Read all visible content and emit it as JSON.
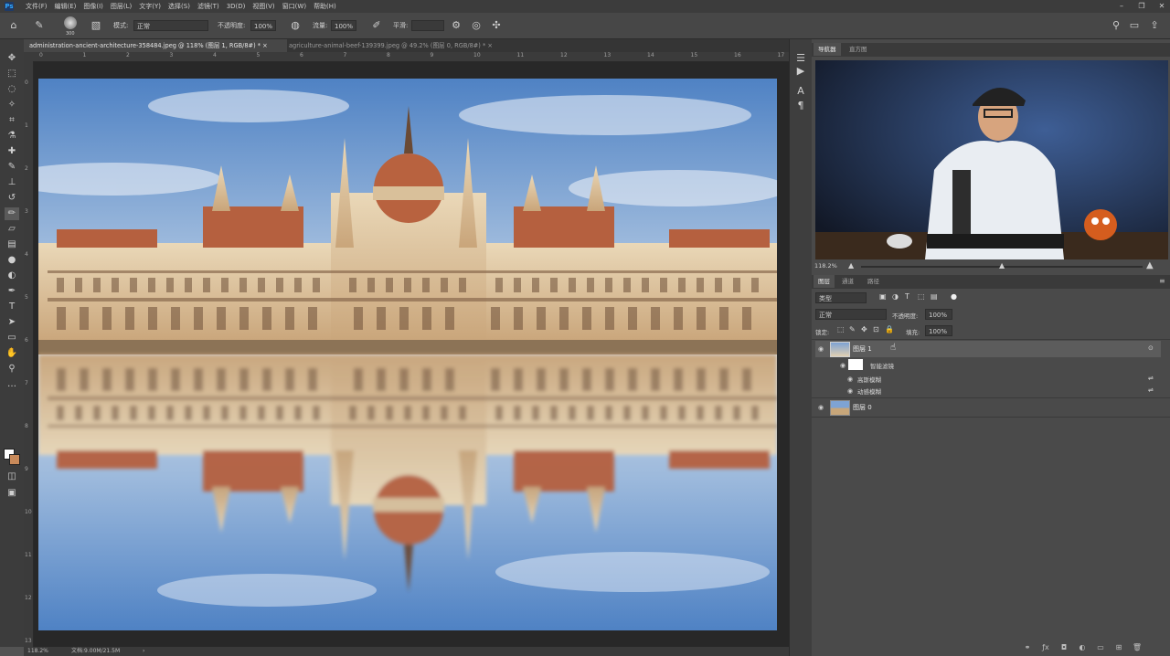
{
  "menubar": {
    "app_logo": "Ps",
    "items": [
      "文件(F)",
      "编辑(E)",
      "图像(I)",
      "图层(L)",
      "文字(Y)",
      "选择(S)",
      "滤镜(T)",
      "3D(D)",
      "视图(V)",
      "窗口(W)",
      "帮助(H)"
    ],
    "window_controls": [
      "–",
      "❐",
      "✕"
    ]
  },
  "options": {
    "brush_size": "300",
    "mode_label": "模式:",
    "mode_value": "正常",
    "opacity_label": "不透明度:",
    "opacity_value": "100%",
    "flow_label": "流量:",
    "flow_value": "100%",
    "smoothing_label": "平滑:"
  },
  "tabs": [
    {
      "label": "administration-ancient-architecture-358484.jpeg @ 118% (图层 1, RGB/8#) *",
      "close": "×"
    },
    {
      "label": "agriculture-animal-beef-139399.jpeg @ 49.2% (图层 0, RGB/8#) *",
      "close": "×"
    }
  ],
  "ruler": {
    "h_labels": [
      "0",
      "1",
      "2",
      "3",
      "4",
      "5",
      "6",
      "7",
      "8",
      "9",
      "10",
      "11",
      "12",
      "13",
      "14",
      "15",
      "16",
      "17"
    ],
    "v_labels": [
      "0",
      "1",
      "2",
      "3",
      "4",
      "5",
      "6",
      "7",
      "8",
      "9",
      "10",
      "11",
      "12",
      "13"
    ]
  },
  "status": {
    "zoom": "118.2%",
    "doc": "文档:9.00M/21.5M",
    "arrow": "›"
  },
  "navigator": {
    "tabs": [
      "导航器",
      "直方图"
    ],
    "zoom": "118.2%"
  },
  "layers": {
    "tabs": [
      "图层",
      "通道",
      "路径"
    ],
    "filter_kind": "类型",
    "blend_mode": "正常",
    "opacity_label": "不透明度:",
    "opacity_value": "100%",
    "lock_label": "锁定:",
    "fill_label": "填充:",
    "fill_value": "100%",
    "items": [
      {
        "name": "图层 1"
      },
      {
        "name": "智能滤镜"
      },
      {
        "name": "高斯模糊"
      },
      {
        "name": "动感模糊"
      },
      {
        "name": "图层 0"
      }
    ]
  },
  "colors": {
    "accent": "#31a8ff",
    "panel": "#4a4a4a",
    "dark": "#3c3c3c"
  }
}
